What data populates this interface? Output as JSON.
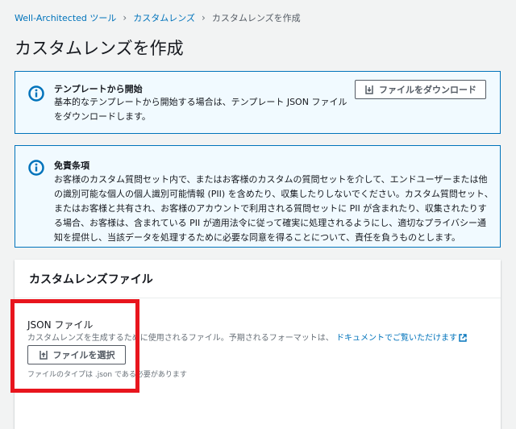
{
  "breadcrumb": {
    "items": [
      "Well-Architected ツール",
      "カスタムレンズ"
    ],
    "current": "カスタムレンズを作成"
  },
  "page_title": "カスタムレンズを作成",
  "alert_template": {
    "title": "テンプレートから開始",
    "body": "基本的なテンプレートから開始する場合は、テンプレート JSON ファイルをダウンロードします。",
    "button_label": "ファイルをダウンロード",
    "icon": "info-icon"
  },
  "alert_disclaimer": {
    "title": "免責条項",
    "body": "お客様のカスタム質問セット内で、またはお客様のカスタムの質問セットを介して、エンドユーザーまたは他の識別可能な個人の個人識別可能情報 (PII) を含めたり、収集したりしないでください。カスタム質問セット、またはお客様と共有され、お客様のアカウントで利用される質問セットに PII が含まれたり、収集されたりする場合、お客様は、含まれている PII が適用法令に従って確実に処理されるようにし、適切なプライバシー通知を提供し、当該データを処理するために必要な同意を得ることについて、責任を負うものとします。",
    "icon": "info-icon"
  },
  "panel": {
    "title": "カスタムレンズファイル",
    "field_label": "JSON ファイル",
    "field_desc": "カスタムレンズを生成するために使用されるファイル。予期されるフォーマットは、",
    "doc_link": "ドキュメントでご覧いただけます",
    "choose_button": "ファイルを選択",
    "constraint": "ファイルのタイプは .json である必要があります"
  },
  "colors": {
    "link": "#0073bb",
    "info_bg": "#f1faff",
    "highlight": "#e8151d"
  }
}
